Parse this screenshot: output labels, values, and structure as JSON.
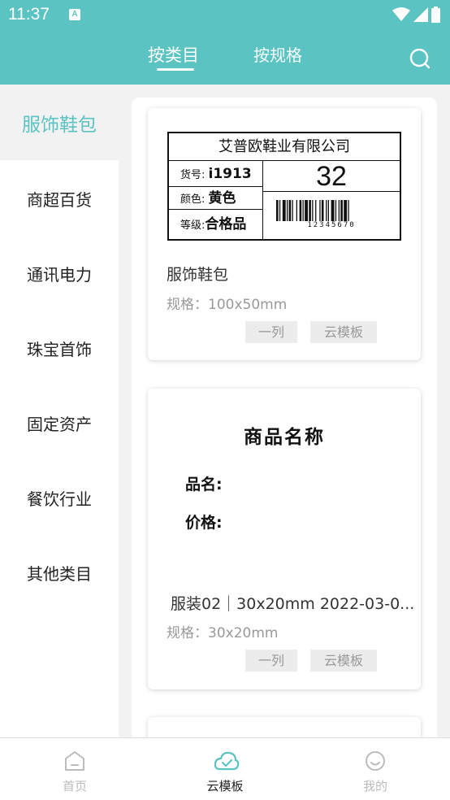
{
  "status": {
    "time": "11:37",
    "badge": "A"
  },
  "header": {
    "tabs": [
      {
        "label": "按类目",
        "active": true
      },
      {
        "label": "按规格",
        "active": false
      }
    ]
  },
  "sidebar": {
    "items": [
      {
        "label": "服饰鞋包",
        "active": true
      },
      {
        "label": "商超百货"
      },
      {
        "label": "通讯电力"
      },
      {
        "label": "珠宝首饰"
      },
      {
        "label": "固定资产"
      },
      {
        "label": "餐饮行业"
      },
      {
        "label": "其他类目"
      }
    ]
  },
  "cards": [
    {
      "preview": {
        "company": "艾普欧鞋业有限公司",
        "item_no_label": "货号:",
        "item_no": "i1913",
        "color_label": "颜色:",
        "color": "黄色",
        "grade_label": "等级:",
        "grade": "合格品",
        "number": "32",
        "barcode": "12345670"
      },
      "name": "服饰鞋包",
      "spec": "规格：100x50mm",
      "buttons": [
        "一列",
        "云模板"
      ]
    },
    {
      "preview": {
        "title": "商品名称",
        "field1": "品名:",
        "field2": "价格:"
      },
      "name": "服装02｜30x20mm 2022-03-0...",
      "spec": "规格：30x20mm",
      "buttons": [
        "一列",
        "云模板"
      ]
    }
  ],
  "bottom_nav": [
    {
      "label": "首页",
      "icon": "home-icon",
      "active": false
    },
    {
      "label": "云模板",
      "icon": "cloud-icon",
      "active": true
    },
    {
      "label": "我的",
      "icon": "profile-icon",
      "active": false
    }
  ],
  "colors": {
    "accent": "#5bc3c2",
    "muted": "#999999",
    "pill_bg": "#ececec"
  }
}
